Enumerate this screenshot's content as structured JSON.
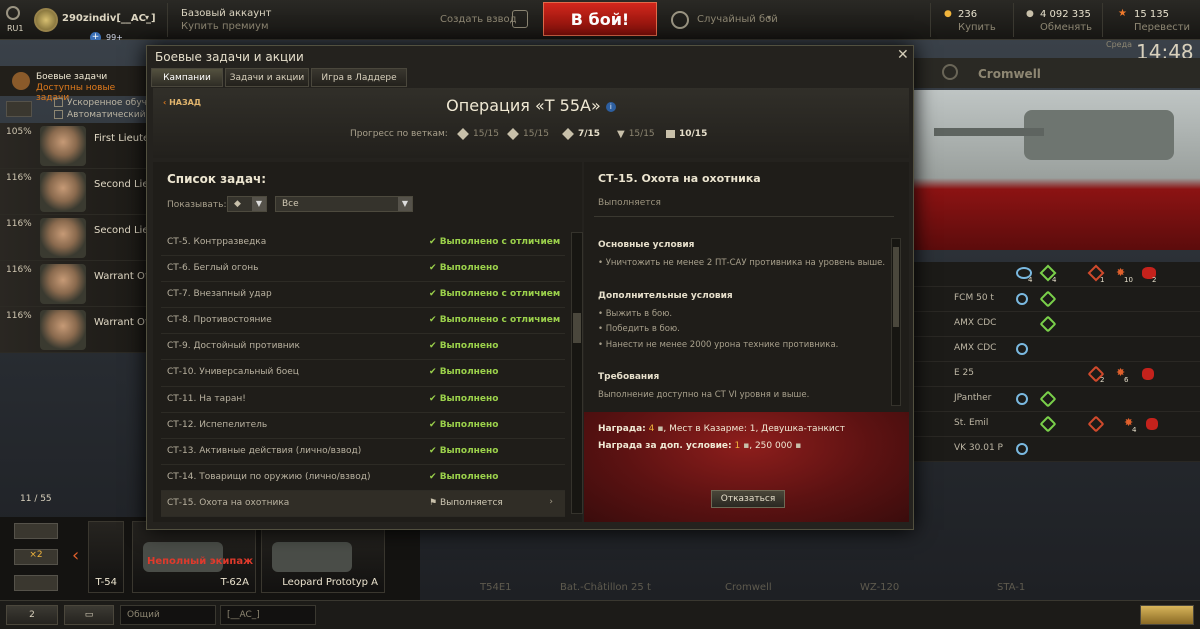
{
  "topbar": {
    "server": "RU1",
    "player": "290zindiv[__AC_]",
    "invite_count": "99+",
    "account_type": "Базовый аккаунт",
    "buy_premium": "Купить премиум",
    "create_platoon": "Создать взвод",
    "battle_button": "В бой!",
    "battle_mode": "Случайный бой",
    "gold_value": "236",
    "gold_label": "Купить",
    "credits_value": "4 092 335",
    "credits_label": "Обменять",
    "xp_value": "15 135",
    "xp_label": "Перевести",
    "day": "Среда",
    "time": "14:48"
  },
  "background": {
    "tank_title": "Cromwell",
    "left_header_title": "Боевые задачи",
    "left_header_sub": "Доступны новые задачи",
    "checkbox_1": "Ускоренное обучен",
    "checkbox_2": "Автоматический во",
    "crew": [
      {
        "pct": "105%",
        "name": "First Lieuten"
      },
      {
        "pct": "116%",
        "name": "Second Lieut"
      },
      {
        "pct": "116%",
        "name": "Second Lieut"
      },
      {
        "pct": "116%",
        "name": "Warrant Offic"
      },
      {
        "pct": "116%",
        "name": "Warrant Offic"
      }
    ],
    "right_list": [
      {
        "name": "FCM 50 t"
      },
      {
        "name": "AMX CDC"
      },
      {
        "name": "AMX CDC"
      },
      {
        "name": "E 25"
      },
      {
        "name": "JPanther"
      },
      {
        "name": "St. Emil"
      },
      {
        "name": "VK 30.01 P"
      }
    ],
    "right_top_counts": [
      "4",
      "4",
      "1",
      "10",
      "2"
    ],
    "right_e25_counts": [
      "2",
      "6"
    ],
    "right_stemil_count": "4",
    "carousel_counter": "11 / 55",
    "carousel_x2": "×2",
    "vehicles": [
      {
        "name": "T-54",
        "note": ""
      },
      {
        "name": "T-62A",
        "note": "Неполный экипаж"
      },
      {
        "name": "Leopard Prototyp A",
        "note": ""
      }
    ],
    "bottom_tanks": [
      "T54E1",
      "Bat.-Châtillon 25 t",
      "Cromwell",
      "WZ-120",
      "STA-1"
    ],
    "bottom_bar": {
      "friends": "2",
      "channel_general": "Общий",
      "channel_clan": "[__AC_]"
    }
  },
  "dialog": {
    "title": "Боевые задачи и акции",
    "tabs": [
      "Кампании",
      "Задачи и акции",
      "Игра в Ладдере"
    ],
    "back": "НАЗАД",
    "operation_title": "Операция «T 55A»",
    "progress_label": "Прогресс по веткам:",
    "branches": [
      {
        "value": "15/15",
        "bold": false
      },
      {
        "value": "15/15",
        "bold": false
      },
      {
        "value": "7/15",
        "bold": true
      },
      {
        "value": "15/15",
        "bold": false
      },
      {
        "value": "10/15",
        "bold": true
      }
    ],
    "list_title": "Список задач:",
    "show_label": "Показывать:",
    "filter_value": "Все",
    "tasks": [
      {
        "name": "СТ-5. Контрразведка",
        "status": "Выполнено с отличием",
        "done": true
      },
      {
        "name": "СТ-6. Беглый огонь",
        "status": "Выполнено",
        "done": true
      },
      {
        "name": "СТ-7. Внезапный удар",
        "status": "Выполнено с отличием",
        "done": true
      },
      {
        "name": "СТ-8. Противостояние",
        "status": "Выполнено с отличием",
        "done": true
      },
      {
        "name": "СТ-9. Достойный противник",
        "status": "Выполнено",
        "done": true
      },
      {
        "name": "СТ-10. Универсальный боец",
        "status": "Выполнено",
        "done": true
      },
      {
        "name": "СТ-11. На таран!",
        "status": "Выполнено",
        "done": true
      },
      {
        "name": "СТ-12. Испепелитель",
        "status": "Выполнено",
        "done": true
      },
      {
        "name": "СТ-13. Активные действия (лично/взвод)",
        "status": "Выполнено",
        "done": true
      },
      {
        "name": "СТ-14. Товарищи по оружию (лично/взвод)",
        "status": "Выполнено",
        "done": true
      },
      {
        "name": "СТ-15. Охота на охотника",
        "status": "Выполняется",
        "done": false
      }
    ],
    "detail": {
      "title": "СТ-15. Охота на охотника",
      "state": "Выполняется",
      "main_conditions_title": "Основные условия",
      "main_conditions": [
        "• Уничтожить не менее 2 ПТ-САУ противника на уровень выше."
      ],
      "extra_conditions_title": "Дополнительные условия",
      "extra_conditions": [
        "• Выжить в бою.",
        "• Победить в бою.",
        "• Нанести не менее 2000 урона технике противника."
      ],
      "requirements_title": "Требования",
      "requirements": "Выполнение доступно на СТ VI уровня и выше.",
      "reward_label": "Награда:",
      "reward_count": "4",
      "reward_rest": ", Мест в Казарме: 1, Девушка-танкист",
      "bonus_label": "Награда за доп. условие:",
      "bonus_count": "1",
      "bonus_rest": ", 250 000",
      "refuse_button": "Отказаться"
    }
  }
}
